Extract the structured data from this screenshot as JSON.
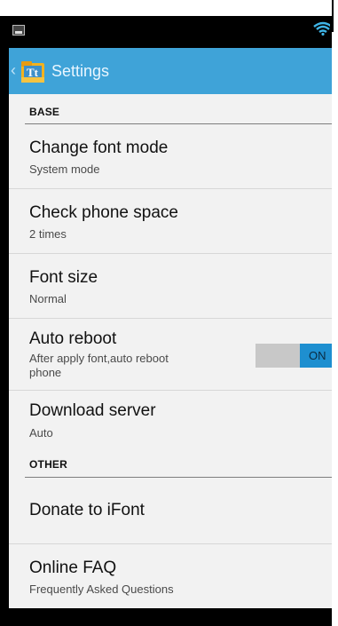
{
  "actionbar": {
    "title": "Settings"
  },
  "sections": {
    "base": "BASE",
    "other": "OTHER"
  },
  "items": {
    "change_font_mode": {
      "title": "Change font mode",
      "subtitle": "System mode"
    },
    "check_phone_space": {
      "title": "Check phone space",
      "subtitle": "2 times"
    },
    "font_size": {
      "title": "Font size",
      "subtitle": "Normal"
    },
    "auto_reboot": {
      "title": "Auto reboot",
      "subtitle_line1": "After apply font,auto reboot",
      "subtitle_line2": "phone",
      "toggle_label": "ON",
      "toggle_state": true
    },
    "download_server": {
      "title": "Download server",
      "subtitle": "Auto"
    },
    "donate": {
      "title": "Donate to iFont"
    },
    "online_faq": {
      "title": "Online FAQ",
      "subtitle": "Frequently Asked Questions"
    }
  },
  "colors": {
    "actionbar": "#3fa3d8",
    "toggle_on": "#1e8fd0",
    "background": "#f2f2f2"
  }
}
